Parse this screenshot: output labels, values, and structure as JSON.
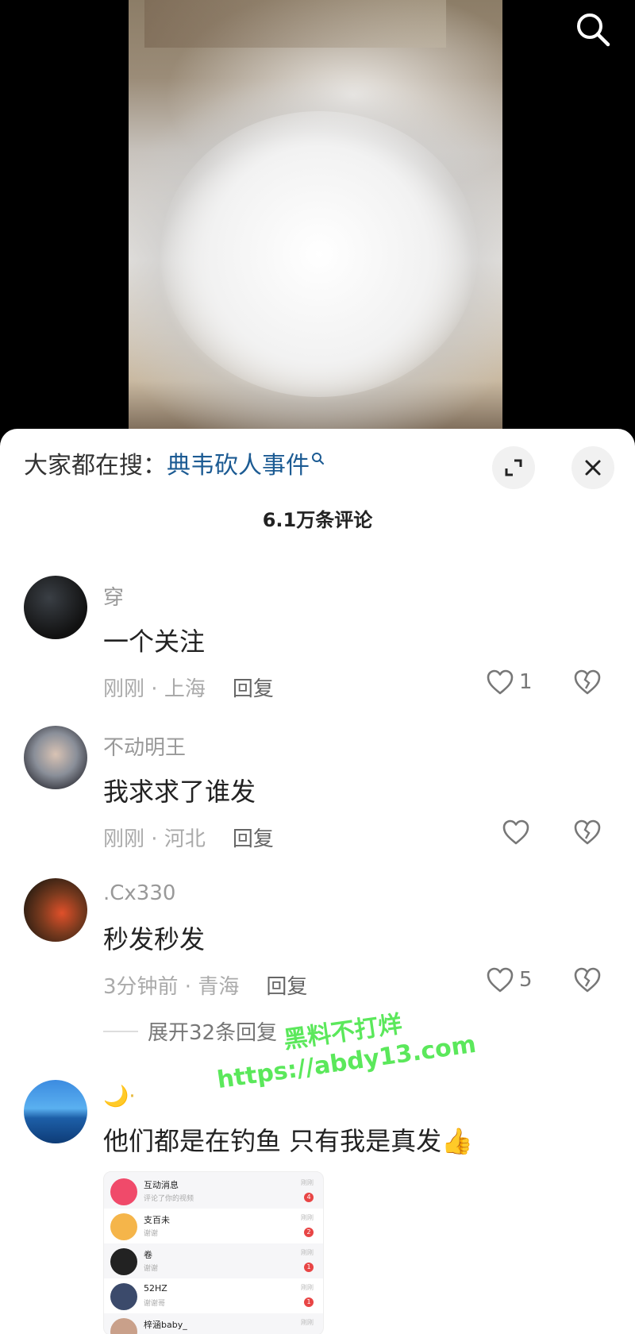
{
  "sheet": {
    "trending_prefix": "大家都在搜：",
    "trending_query": "典韦砍人事件",
    "comment_count_title": "6.1万条评论"
  },
  "comments": [
    {
      "username": "穿",
      "text": "一个关注",
      "time": "刚刚",
      "location": "上海",
      "reply_label": "回复",
      "likes": "1"
    },
    {
      "username": "不动明王",
      "text": "我求求了谁发",
      "time": "刚刚",
      "location": "河北",
      "reply_label": "回复",
      "likes": ""
    },
    {
      "username": ".Cx330",
      "text": "秒发秒发",
      "time": "3分钟前",
      "location": "青海",
      "reply_label": "回复",
      "likes": "5",
      "expand_replies": "展开32条回复"
    },
    {
      "username": "🌙·",
      "text": "他们都是在钓鱼 只有我是真发",
      "emoji": "👍"
    }
  ],
  "watermark": {
    "line1": "黑料不打烊",
    "line2": "https://abdy13.com"
  },
  "embedded_screenshot": {
    "rows": [
      {
        "name": "互动消息",
        "sub": "评论了你的视频",
        "tag": "刚刚",
        "badge": "4",
        "color": "#f04a6a"
      },
      {
        "name": "支百未",
        "sub": "谢谢",
        "tag": "刚刚",
        "badge": "2",
        "color": "#f5b54a"
      },
      {
        "name": "卷",
        "sub": "谢谢",
        "tag": "刚刚",
        "badge": "1",
        "color": "#222222"
      },
      {
        "name": "52HZ",
        "sub": "谢谢哥",
        "tag": "刚刚",
        "badge": "1",
        "color": "#3b4a6b"
      },
      {
        "name": "梓涵baby_",
        "sub": "",
        "tag": "刚刚",
        "badge": "",
        "color": "#c9a08a"
      }
    ]
  },
  "colors": {
    "link_blue": "#1c5b93",
    "meta_gray": "#aaaaaa",
    "watermark_green": "#5be85b"
  }
}
